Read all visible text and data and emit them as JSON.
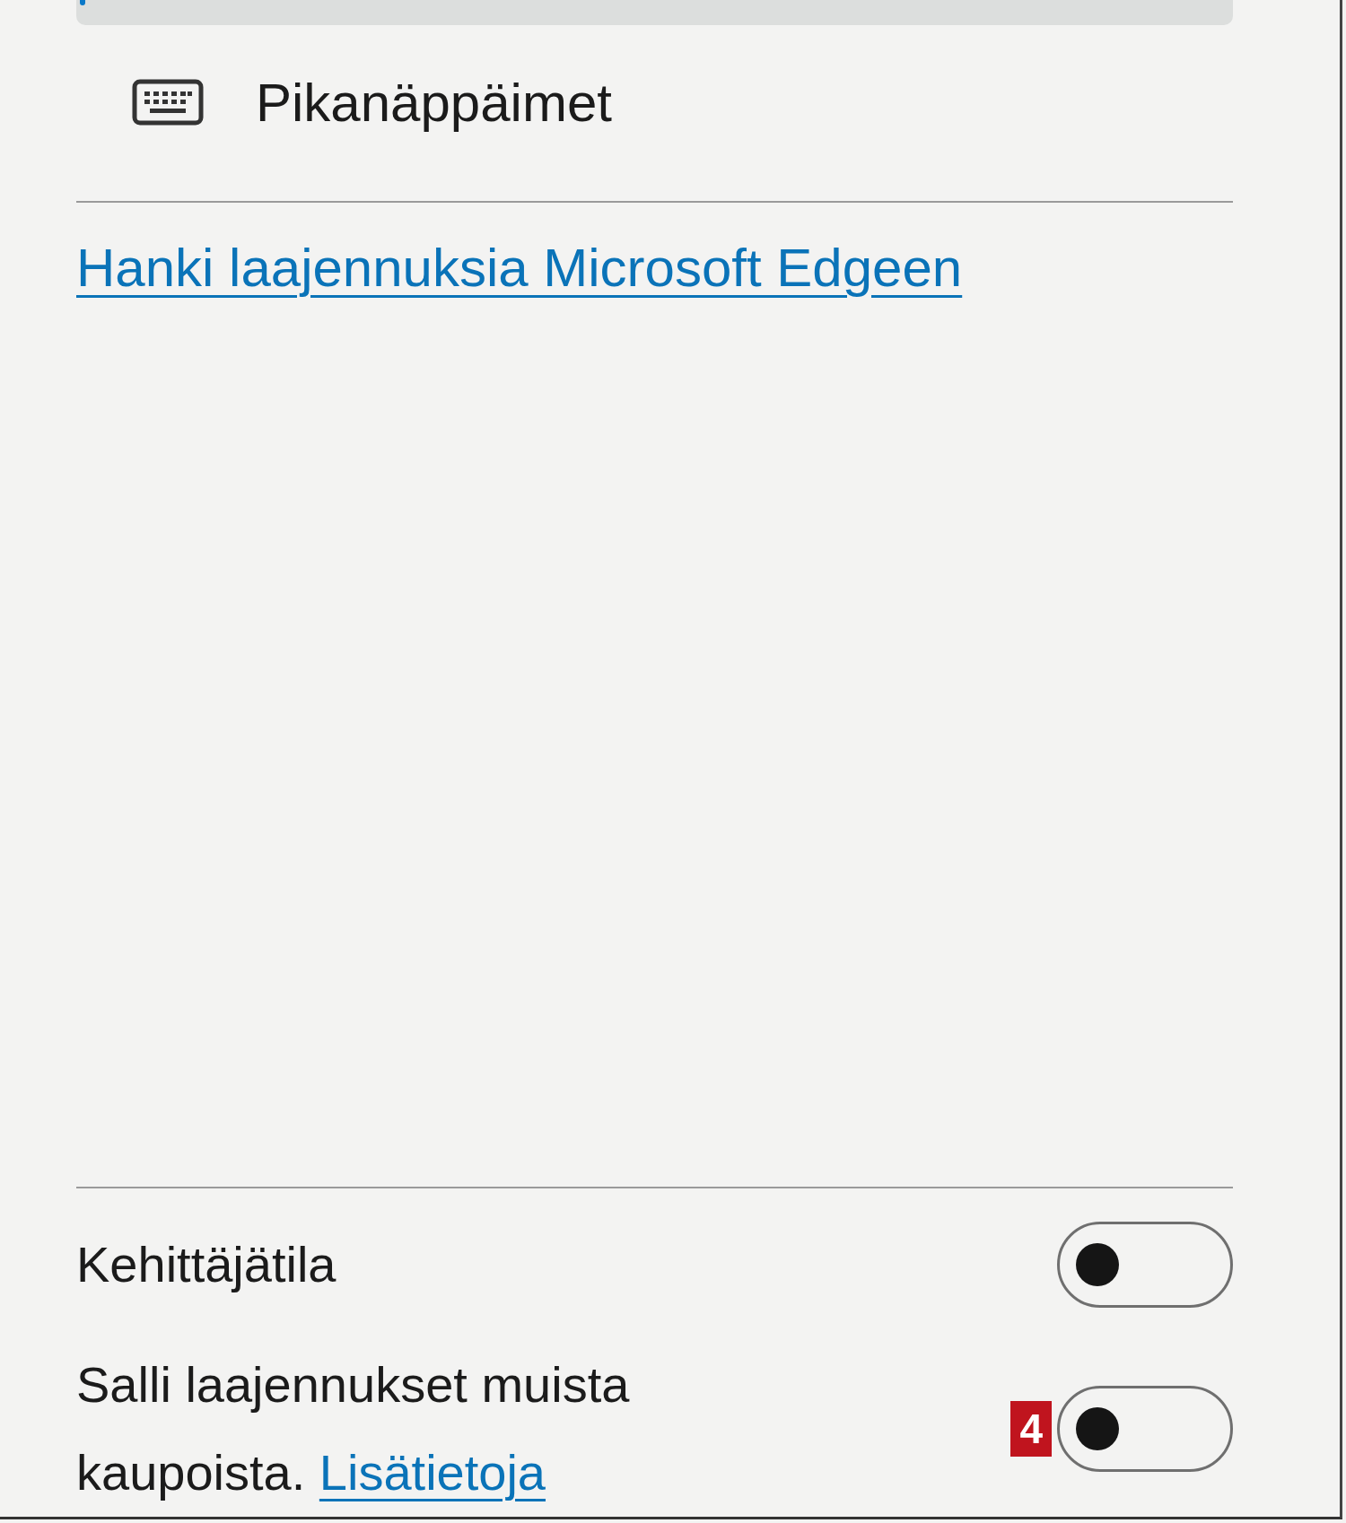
{
  "menu_items": [
    {
      "selected": true
    },
    {
      "label": "Pikanäppäimet",
      "selected": false
    }
  ],
  "store_link": "Hanki laajennuksia Microsoft Edgeen",
  "settings": [
    {
      "label": "Kehittäjätila",
      "on": false
    },
    {
      "label": "Salli laajennukset muista kaupoista.",
      "link": "Lisätietoja",
      "badge": "4",
      "on": false
    }
  ]
}
